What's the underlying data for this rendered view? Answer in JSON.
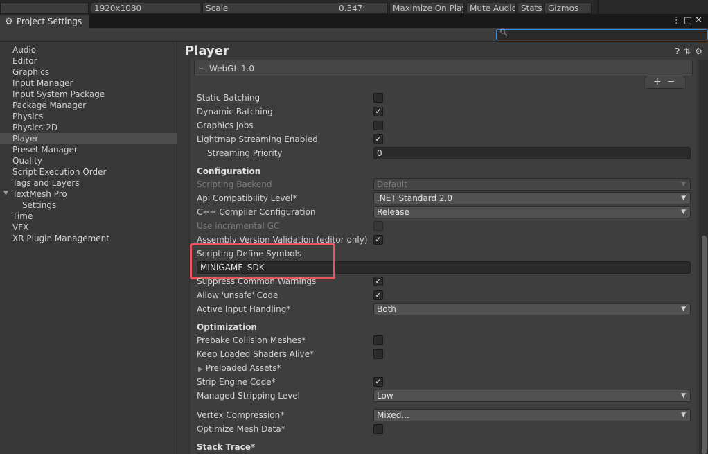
{
  "topbar": {
    "resolution": "1920x1080",
    "scale_label": "Scale",
    "scale_value": "0.347:",
    "maximize": "Maximize On Play",
    "mute": "Mute Audio",
    "stats": "Stats",
    "gizmos": "Gizmos"
  },
  "window": {
    "tab_title": "Project Settings",
    "search_placeholder": ""
  },
  "sidebar": {
    "items": [
      {
        "label": "Audio"
      },
      {
        "label": "Editor"
      },
      {
        "label": "Graphics"
      },
      {
        "label": "Input Manager"
      },
      {
        "label": "Input System Package"
      },
      {
        "label": "Package Manager"
      },
      {
        "label": "Physics"
      },
      {
        "label": "Physics 2D"
      },
      {
        "label": "Player",
        "selected": true
      },
      {
        "label": "Preset Manager"
      },
      {
        "label": "Quality"
      },
      {
        "label": "Script Execution Order"
      },
      {
        "label": "Tags and Layers"
      },
      {
        "label": "TextMesh Pro",
        "expanded": true
      },
      {
        "label": "Settings",
        "child": true
      },
      {
        "label": "Time"
      },
      {
        "label": "VFX"
      },
      {
        "label": "XR Plugin Management"
      }
    ]
  },
  "player": {
    "title": "Player",
    "graphics_api": "WebGL 1.0",
    "rows": {
      "static_batching": {
        "label": "Static Batching",
        "checked": false
      },
      "dynamic_batching": {
        "label": "Dynamic Batching",
        "checked": true
      },
      "graphics_jobs": {
        "label": "Graphics Jobs",
        "checked": false
      },
      "lightmap_streaming": {
        "label": "Lightmap Streaming Enabled",
        "checked": true
      },
      "streaming_priority": {
        "label": "Streaming Priority",
        "value": "0"
      }
    },
    "configuration": {
      "header": "Configuration",
      "scripting_backend": {
        "label": "Scripting Backend",
        "value": "Default"
      },
      "api_compat": {
        "label": "Api Compatibility Level*",
        "value": ".NET Standard 2.0"
      },
      "cpp_compiler": {
        "label": "C++ Compiler Configuration",
        "value": "Release"
      },
      "incremental_gc": {
        "label": "Use incremental GC",
        "checked": false
      },
      "assembly_validation": {
        "label": "Assembly Version Validation (editor only)",
        "checked": true
      },
      "define_symbols": {
        "label": "Scripting Define Symbols",
        "value": "MINIGAME_SDK"
      },
      "suppress_warnings": {
        "label": "Suppress Common Warnings",
        "checked": true
      },
      "allow_unsafe": {
        "label": "Allow 'unsafe' Code",
        "checked": true
      },
      "active_input": {
        "label": "Active Input Handling*",
        "value": "Both"
      }
    },
    "optimization": {
      "header": "Optimization",
      "prebake": {
        "label": "Prebake Collision Meshes*",
        "checked": false
      },
      "keep_shaders": {
        "label": "Keep Loaded Shaders Alive*",
        "checked": false
      },
      "preloaded_assets": {
        "label": "Preloaded Assets*"
      },
      "strip_engine": {
        "label": "Strip Engine Code*",
        "checked": true
      },
      "managed_stripping": {
        "label": "Managed Stripping Level",
        "value": "Low"
      },
      "vertex_compression": {
        "label": "Vertex Compression*",
        "value": "Mixed..."
      },
      "optimize_mesh": {
        "label": "Optimize Mesh Data*",
        "checked": false
      }
    },
    "stack_trace": {
      "header": "Stack Trace*"
    }
  },
  "colors": {
    "highlight": "#e8555f",
    "search_focus": "#3b8ad6",
    "selected_row": "#4d4d4d"
  }
}
